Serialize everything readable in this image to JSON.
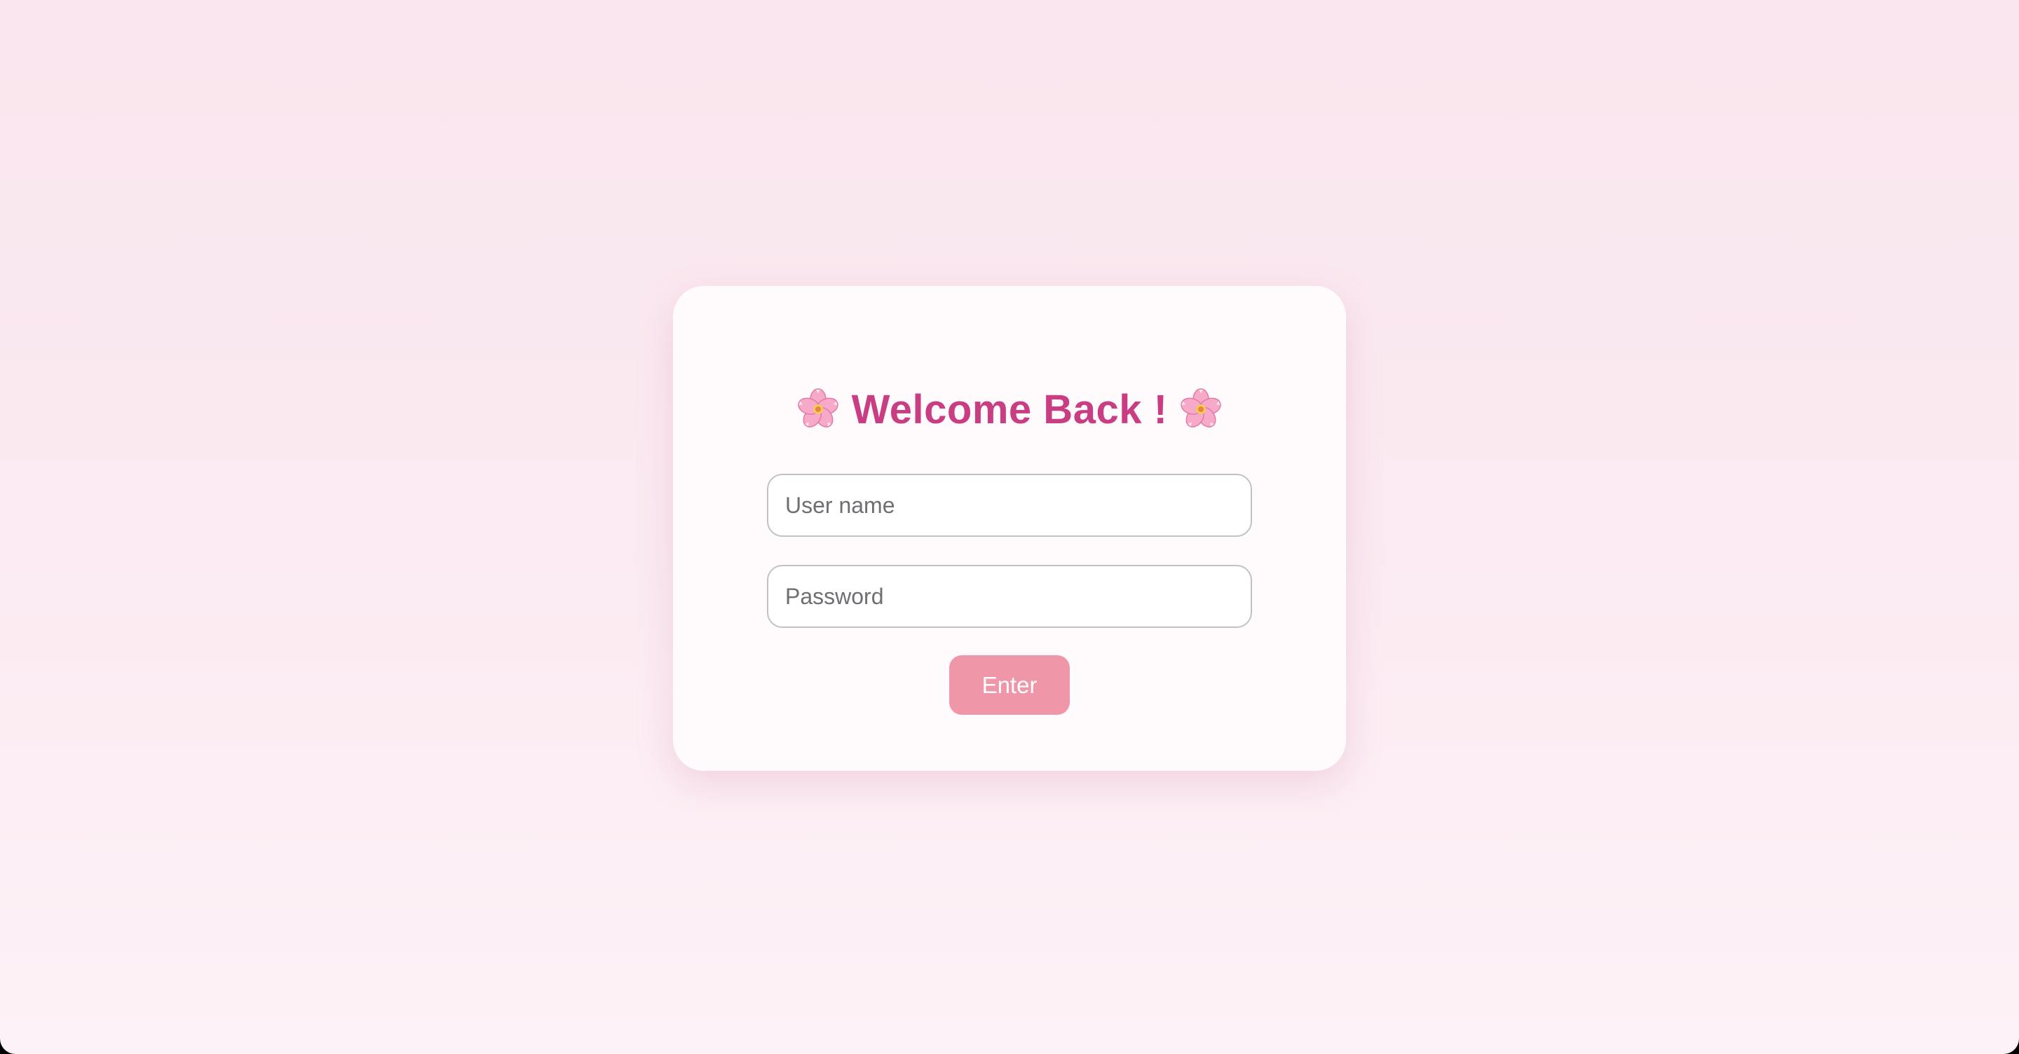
{
  "login": {
    "title": "Welcome Back !",
    "title_icon": "cherry-blossom-icon",
    "username": {
      "value": "",
      "placeholder": "User name"
    },
    "password": {
      "value": "",
      "placeholder": "Password"
    },
    "submit_label": "Enter"
  },
  "colors": {
    "background_top": "#fae6ee",
    "background_bottom": "#fdf2f7",
    "card_background": "#fffbfc",
    "title": "#c93d83",
    "input_border": "#c2c2c4",
    "button_background": "#ef97a8",
    "button_text": "#ffffff"
  }
}
